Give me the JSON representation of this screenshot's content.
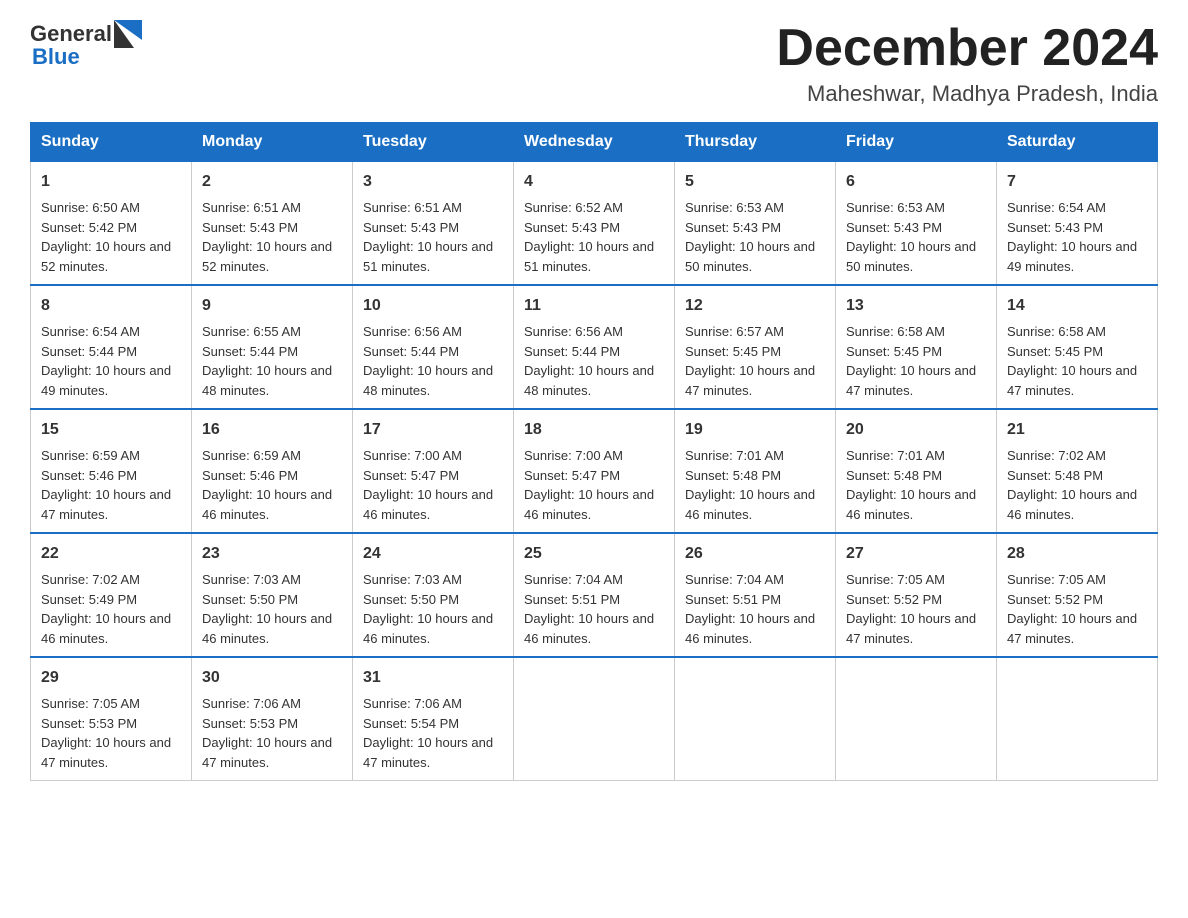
{
  "header": {
    "logo_general": "General",
    "logo_blue": "Blue",
    "month": "December 2024",
    "location": "Maheshwar, Madhya Pradesh, India"
  },
  "weekdays": [
    "Sunday",
    "Monday",
    "Tuesday",
    "Wednesday",
    "Thursday",
    "Friday",
    "Saturday"
  ],
  "weeks": [
    [
      {
        "day": "1",
        "sunrise": "6:50 AM",
        "sunset": "5:42 PM",
        "daylight": "10 hours and 52 minutes."
      },
      {
        "day": "2",
        "sunrise": "6:51 AM",
        "sunset": "5:43 PM",
        "daylight": "10 hours and 52 minutes."
      },
      {
        "day": "3",
        "sunrise": "6:51 AM",
        "sunset": "5:43 PM",
        "daylight": "10 hours and 51 minutes."
      },
      {
        "day": "4",
        "sunrise": "6:52 AM",
        "sunset": "5:43 PM",
        "daylight": "10 hours and 51 minutes."
      },
      {
        "day": "5",
        "sunrise": "6:53 AM",
        "sunset": "5:43 PM",
        "daylight": "10 hours and 50 minutes."
      },
      {
        "day": "6",
        "sunrise": "6:53 AM",
        "sunset": "5:43 PM",
        "daylight": "10 hours and 50 minutes."
      },
      {
        "day": "7",
        "sunrise": "6:54 AM",
        "sunset": "5:43 PM",
        "daylight": "10 hours and 49 minutes."
      }
    ],
    [
      {
        "day": "8",
        "sunrise": "6:54 AM",
        "sunset": "5:44 PM",
        "daylight": "10 hours and 49 minutes."
      },
      {
        "day": "9",
        "sunrise": "6:55 AM",
        "sunset": "5:44 PM",
        "daylight": "10 hours and 48 minutes."
      },
      {
        "day": "10",
        "sunrise": "6:56 AM",
        "sunset": "5:44 PM",
        "daylight": "10 hours and 48 minutes."
      },
      {
        "day": "11",
        "sunrise": "6:56 AM",
        "sunset": "5:44 PM",
        "daylight": "10 hours and 48 minutes."
      },
      {
        "day": "12",
        "sunrise": "6:57 AM",
        "sunset": "5:45 PM",
        "daylight": "10 hours and 47 minutes."
      },
      {
        "day": "13",
        "sunrise": "6:58 AM",
        "sunset": "5:45 PM",
        "daylight": "10 hours and 47 minutes."
      },
      {
        "day": "14",
        "sunrise": "6:58 AM",
        "sunset": "5:45 PM",
        "daylight": "10 hours and 47 minutes."
      }
    ],
    [
      {
        "day": "15",
        "sunrise": "6:59 AM",
        "sunset": "5:46 PM",
        "daylight": "10 hours and 47 minutes."
      },
      {
        "day": "16",
        "sunrise": "6:59 AM",
        "sunset": "5:46 PM",
        "daylight": "10 hours and 46 minutes."
      },
      {
        "day": "17",
        "sunrise": "7:00 AM",
        "sunset": "5:47 PM",
        "daylight": "10 hours and 46 minutes."
      },
      {
        "day": "18",
        "sunrise": "7:00 AM",
        "sunset": "5:47 PM",
        "daylight": "10 hours and 46 minutes."
      },
      {
        "day": "19",
        "sunrise": "7:01 AM",
        "sunset": "5:48 PM",
        "daylight": "10 hours and 46 minutes."
      },
      {
        "day": "20",
        "sunrise": "7:01 AM",
        "sunset": "5:48 PM",
        "daylight": "10 hours and 46 minutes."
      },
      {
        "day": "21",
        "sunrise": "7:02 AM",
        "sunset": "5:48 PM",
        "daylight": "10 hours and 46 minutes."
      }
    ],
    [
      {
        "day": "22",
        "sunrise": "7:02 AM",
        "sunset": "5:49 PM",
        "daylight": "10 hours and 46 minutes."
      },
      {
        "day": "23",
        "sunrise": "7:03 AM",
        "sunset": "5:50 PM",
        "daylight": "10 hours and 46 minutes."
      },
      {
        "day": "24",
        "sunrise": "7:03 AM",
        "sunset": "5:50 PM",
        "daylight": "10 hours and 46 minutes."
      },
      {
        "day": "25",
        "sunrise": "7:04 AM",
        "sunset": "5:51 PM",
        "daylight": "10 hours and 46 minutes."
      },
      {
        "day": "26",
        "sunrise": "7:04 AM",
        "sunset": "5:51 PM",
        "daylight": "10 hours and 46 minutes."
      },
      {
        "day": "27",
        "sunrise": "7:05 AM",
        "sunset": "5:52 PM",
        "daylight": "10 hours and 47 minutes."
      },
      {
        "day": "28",
        "sunrise": "7:05 AM",
        "sunset": "5:52 PM",
        "daylight": "10 hours and 47 minutes."
      }
    ],
    [
      {
        "day": "29",
        "sunrise": "7:05 AM",
        "sunset": "5:53 PM",
        "daylight": "10 hours and 47 minutes."
      },
      {
        "day": "30",
        "sunrise": "7:06 AM",
        "sunset": "5:53 PM",
        "daylight": "10 hours and 47 minutes."
      },
      {
        "day": "31",
        "sunrise": "7:06 AM",
        "sunset": "5:54 PM",
        "daylight": "10 hours and 47 minutes."
      },
      null,
      null,
      null,
      null
    ]
  ]
}
